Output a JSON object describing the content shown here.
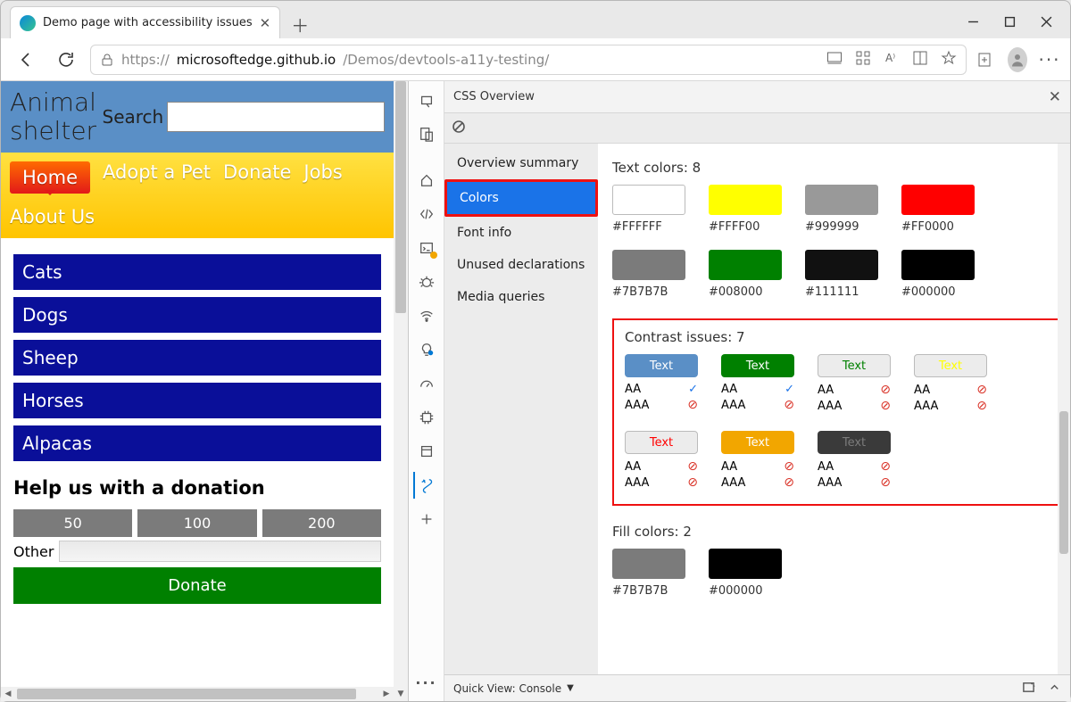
{
  "browser": {
    "tab_title": "Demo page with accessibility issues",
    "url_proto": "https://",
    "url_host": "microsoftedge.github.io",
    "url_path": "/Demos/devtools-a11y-testing/"
  },
  "page": {
    "site_title": "Animal shelter",
    "search_label": "Search",
    "nav": {
      "home": "Home",
      "adopt": "Adopt a Pet",
      "donate": "Donate",
      "jobs": "Jobs",
      "about": "About Us"
    },
    "animals": [
      "Cats",
      "Dogs",
      "Sheep",
      "Horses",
      "Alpacas"
    ],
    "donation": {
      "heading": "Help us with a donation",
      "amounts": [
        "50",
        "100",
        "200"
      ],
      "other_label": "Other",
      "button": "Donate"
    }
  },
  "devtools": {
    "panel_title": "CSS Overview",
    "sidebar": {
      "items": [
        "Overview summary",
        "Colors",
        "Font info",
        "Unused declarations",
        "Media queries"
      ],
      "selected": "Colors"
    },
    "text_colors": {
      "title": "Text colors: 8",
      "swatches": [
        {
          "hex": "#FFFFFF",
          "border": true
        },
        {
          "hex": "#FFFF00"
        },
        {
          "hex": "#999999"
        },
        {
          "hex": "#FF0000"
        },
        {
          "hex": "#7B7B7B"
        },
        {
          "hex": "#008000"
        },
        {
          "hex": "#111111"
        },
        {
          "hex": "#000000"
        }
      ]
    },
    "contrast": {
      "title": "Contrast issues: 7",
      "chip_label": "Text",
      "aa": "AA",
      "aaa": "AAA",
      "items": [
        {
          "bg": "#5a8fc6",
          "fg": "#ffffff",
          "border": false,
          "aa": "ok",
          "aaa": "bad"
        },
        {
          "bg": "#008000",
          "fg": "#ffffff",
          "border": false,
          "aa": "ok",
          "aaa": "bad"
        },
        {
          "bg": "#ececec",
          "fg": "#008000",
          "border": true,
          "aa": "bad",
          "aaa": "bad"
        },
        {
          "bg": "#ececec",
          "fg": "#FFFF00",
          "border": true,
          "aa": "bad",
          "aaa": "bad"
        },
        {
          "bg": "#ececec",
          "fg": "#FF0000",
          "border": true,
          "aa": "bad",
          "aaa": "bad"
        },
        {
          "bg": "#f2a600",
          "fg": "#ffffff",
          "border": false,
          "aa": "bad",
          "aaa": "bad"
        },
        {
          "bg": "#3a3a3a",
          "fg": "#7B7B7B",
          "border": false,
          "aa": "bad",
          "aaa": "bad"
        }
      ]
    },
    "fill_colors": {
      "title": "Fill colors: 2",
      "swatches": [
        {
          "hex": "#7B7B7B"
        },
        {
          "hex": "#000000"
        }
      ]
    },
    "footer": {
      "quick_view": "Quick View:",
      "console": "Console"
    }
  }
}
